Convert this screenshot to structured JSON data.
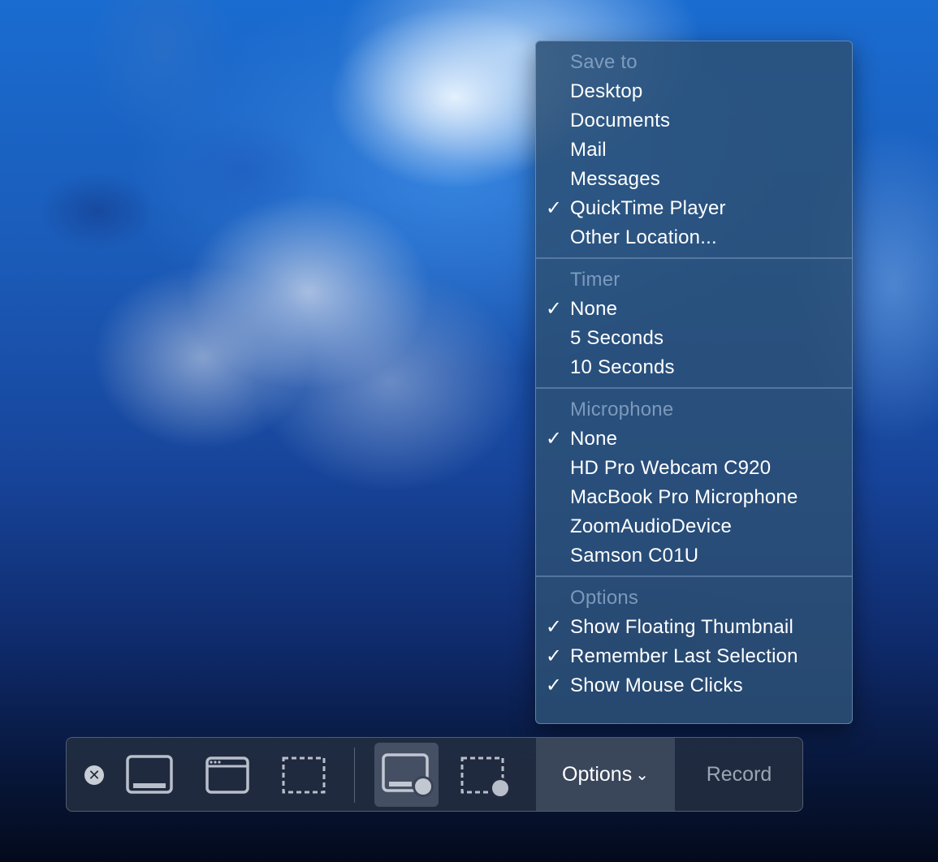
{
  "menu": {
    "sections": [
      {
        "header": "Save to",
        "items": [
          {
            "label": "Desktop",
            "checked": false
          },
          {
            "label": "Documents",
            "checked": false
          },
          {
            "label": "Mail",
            "checked": false
          },
          {
            "label": "Messages",
            "checked": false
          },
          {
            "label": "QuickTime Player",
            "checked": true
          },
          {
            "label": "Other Location...",
            "checked": false
          }
        ]
      },
      {
        "header": "Timer",
        "items": [
          {
            "label": "None",
            "checked": true
          },
          {
            "label": "5 Seconds",
            "checked": false
          },
          {
            "label": "10 Seconds",
            "checked": false
          }
        ]
      },
      {
        "header": "Microphone",
        "items": [
          {
            "label": "None",
            "checked": true
          },
          {
            "label": "HD Pro Webcam C920",
            "checked": false
          },
          {
            "label": "MacBook Pro Microphone",
            "checked": false
          },
          {
            "label": "ZoomAudioDevice",
            "checked": false
          },
          {
            "label": "Samson C01U",
            "checked": false
          }
        ]
      },
      {
        "header": "Options",
        "items": [
          {
            "label": "Show Floating Thumbnail",
            "checked": true
          },
          {
            "label": "Remember Last Selection",
            "checked": true
          },
          {
            "label": "Show Mouse Clicks",
            "checked": true
          }
        ]
      }
    ],
    "check_glyph": "✓"
  },
  "toolbar": {
    "close_glyph": "✕",
    "options_label": "Options",
    "options_chevron": "⌄",
    "record_label": "Record",
    "tools": [
      {
        "icon": "capture-entire-screen-icon"
      },
      {
        "icon": "capture-window-icon"
      },
      {
        "icon": "capture-selection-icon"
      },
      {
        "icon": "record-entire-screen-icon",
        "selected": true
      },
      {
        "icon": "record-selection-icon"
      }
    ]
  }
}
